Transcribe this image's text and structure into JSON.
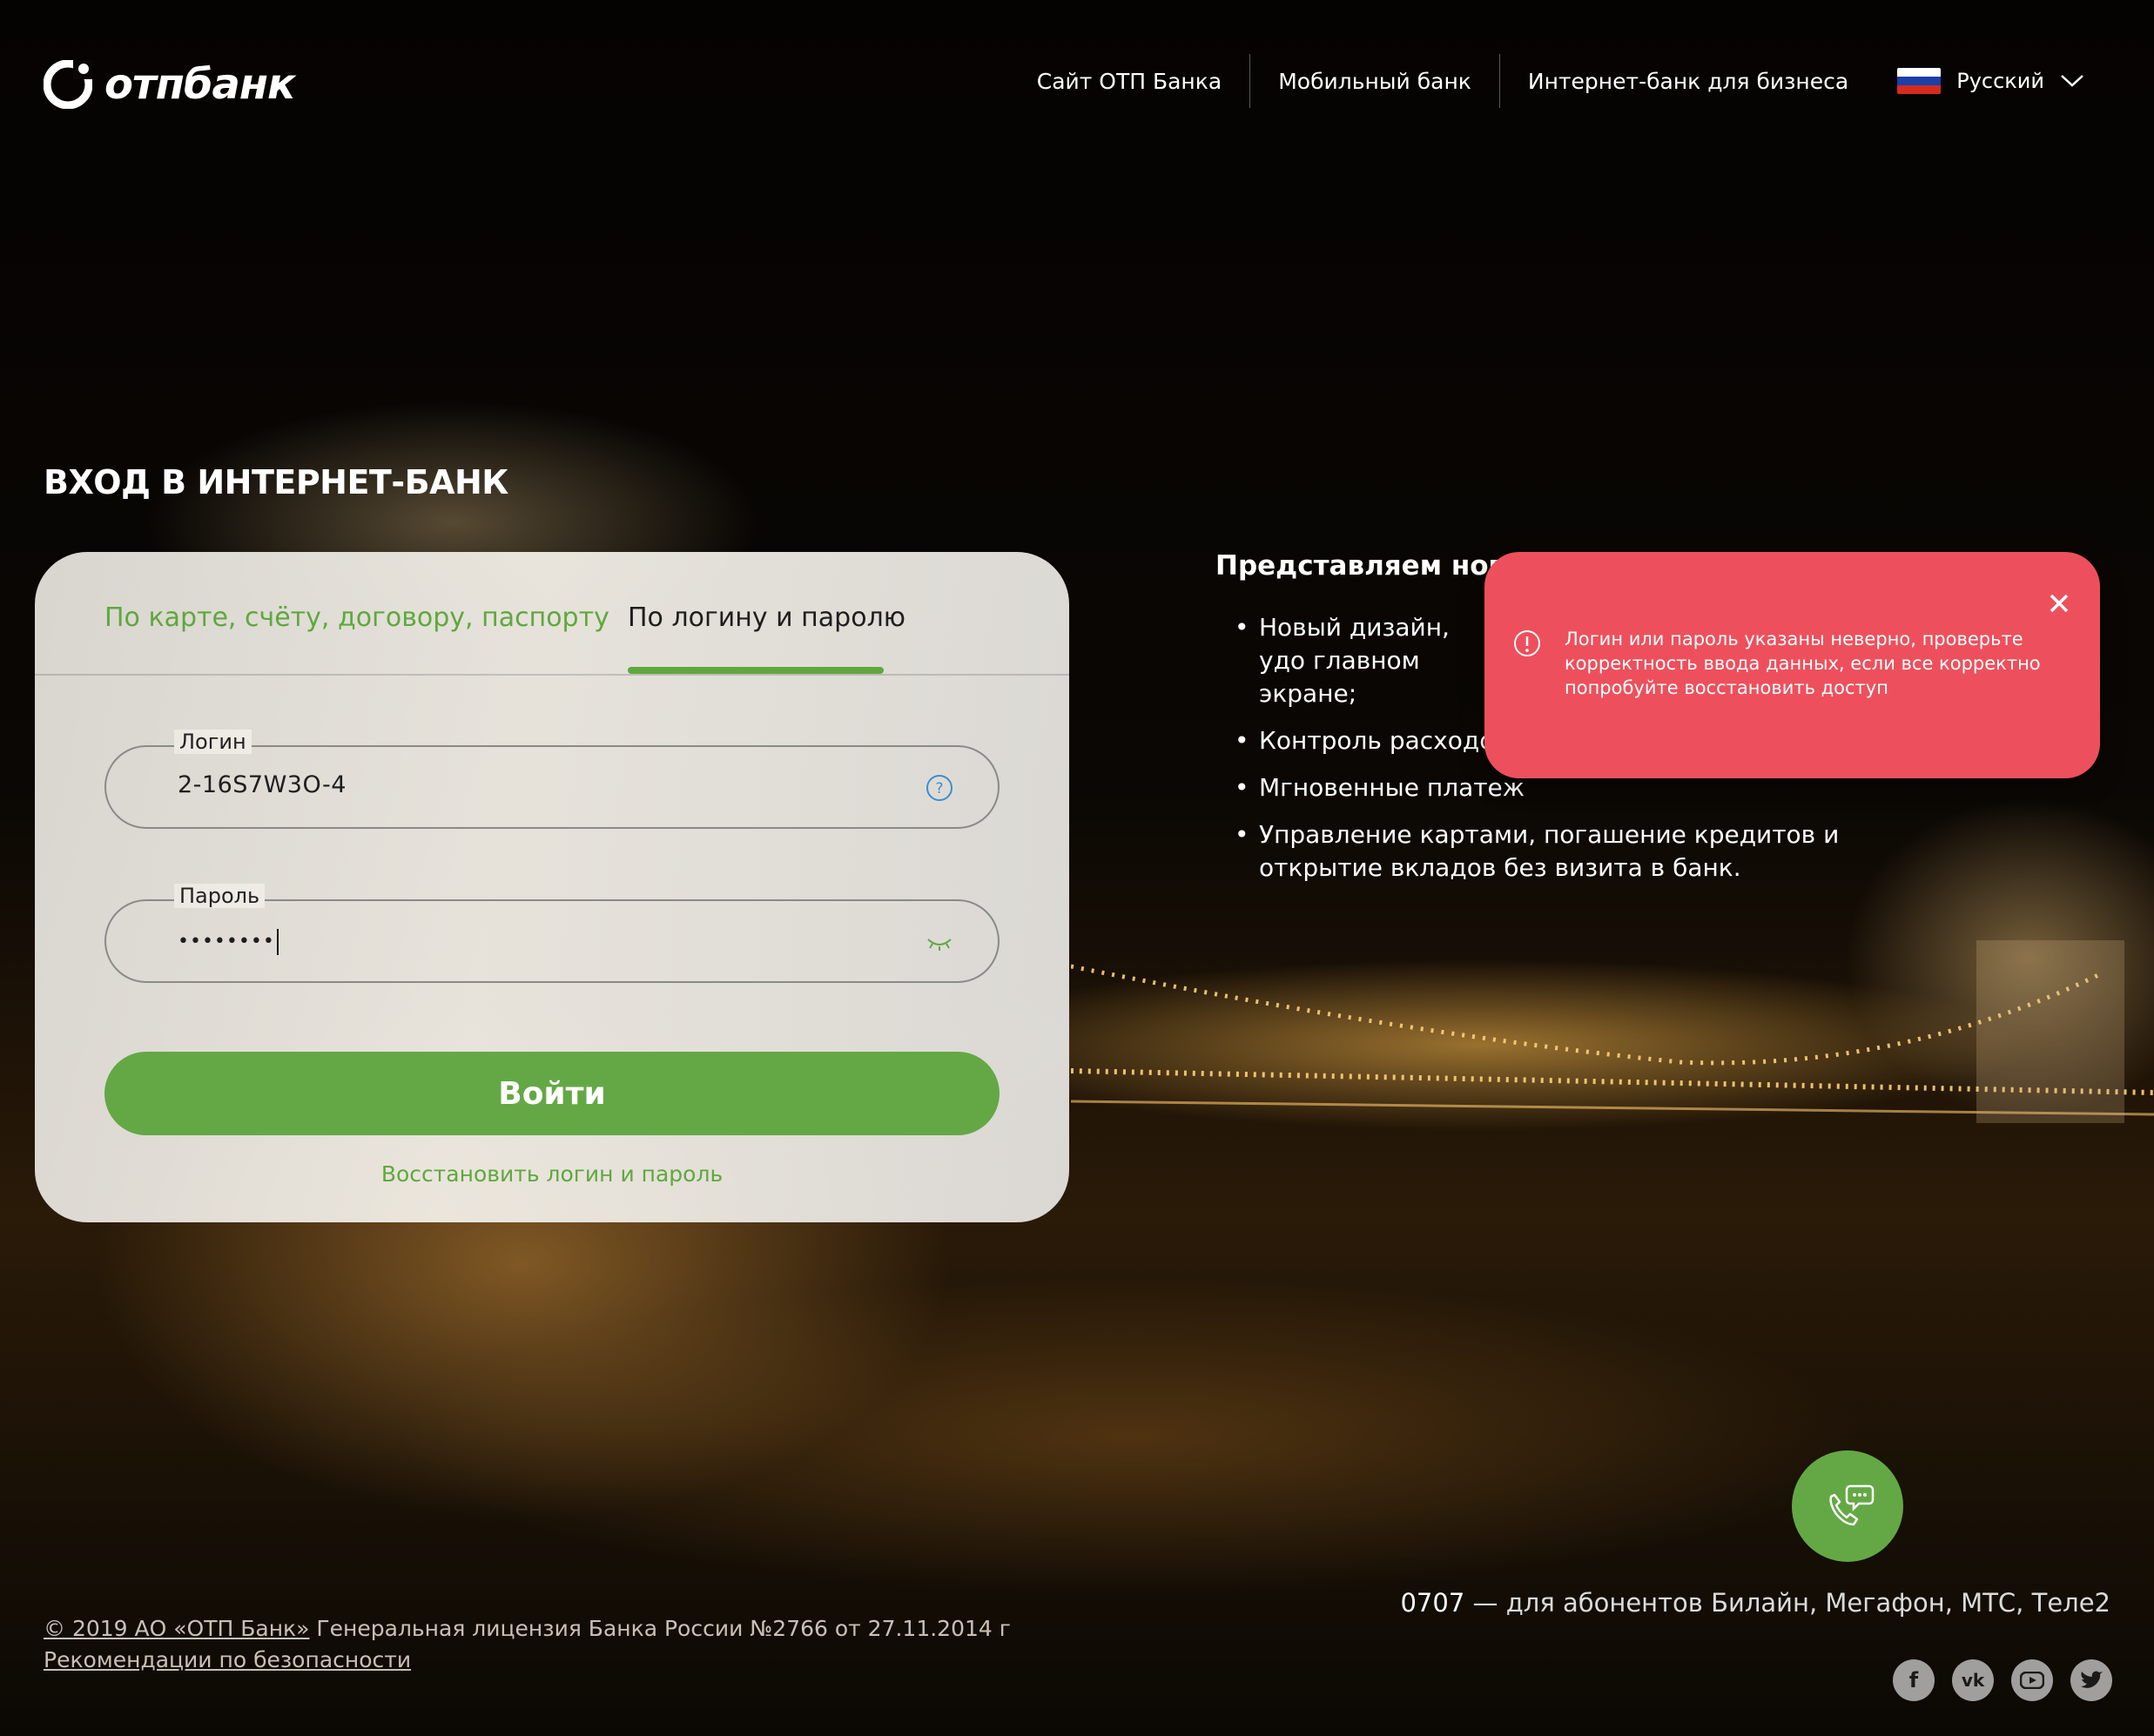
{
  "header": {
    "logo_text": "отпбанк",
    "nav": [
      "Сайт ОТП Банка",
      "Мобильный банк",
      "Интернет-банк для бизнеса"
    ],
    "language": "Русский"
  },
  "page_title": "ВХОД В ИНТЕРНЕТ-БАНК",
  "login_card": {
    "tabs": [
      "По карте, счёту, договору, паспорту",
      "По логину и паролю"
    ],
    "active_tab": 1,
    "login_label": "Логин",
    "login_value": "2-16S7W3O-4",
    "password_label": "Пароль",
    "password_value": "••••••••",
    "submit_label": "Войти",
    "restore_link": "Восстановить логин и пароль"
  },
  "promo": {
    "title": "Представляем новый",
    "items": [
      "Новый дизайн, удо главном экране;",
      "Контроль расходо",
      "Мгновенные платеж",
      "Управление картами, погашение кредитов и открытие вкладов без визита в банк."
    ]
  },
  "error_toast": {
    "message": "Логин или пароль указаны неверно, проверьте корректность ввода данных, если все корректно попробуйте восстановить доступ"
  },
  "footer": {
    "hotline_number": "0707",
    "hotline_text": " — для абонентов Билайн, Мегафон, МТС, Теле2",
    "copyright_link": "© 2019 АО «ОТП Банк»",
    "license_text": " Генеральная лицензия Банка России №2766 от 27.11.2014 г",
    "security_link": "Рекомендации по безопасности",
    "socials": [
      "facebook-icon",
      "vk-icon",
      "youtube-icon",
      "twitter-icon"
    ]
  },
  "colors": {
    "brand_green": "#64a845",
    "error_red": "#ed505c"
  }
}
